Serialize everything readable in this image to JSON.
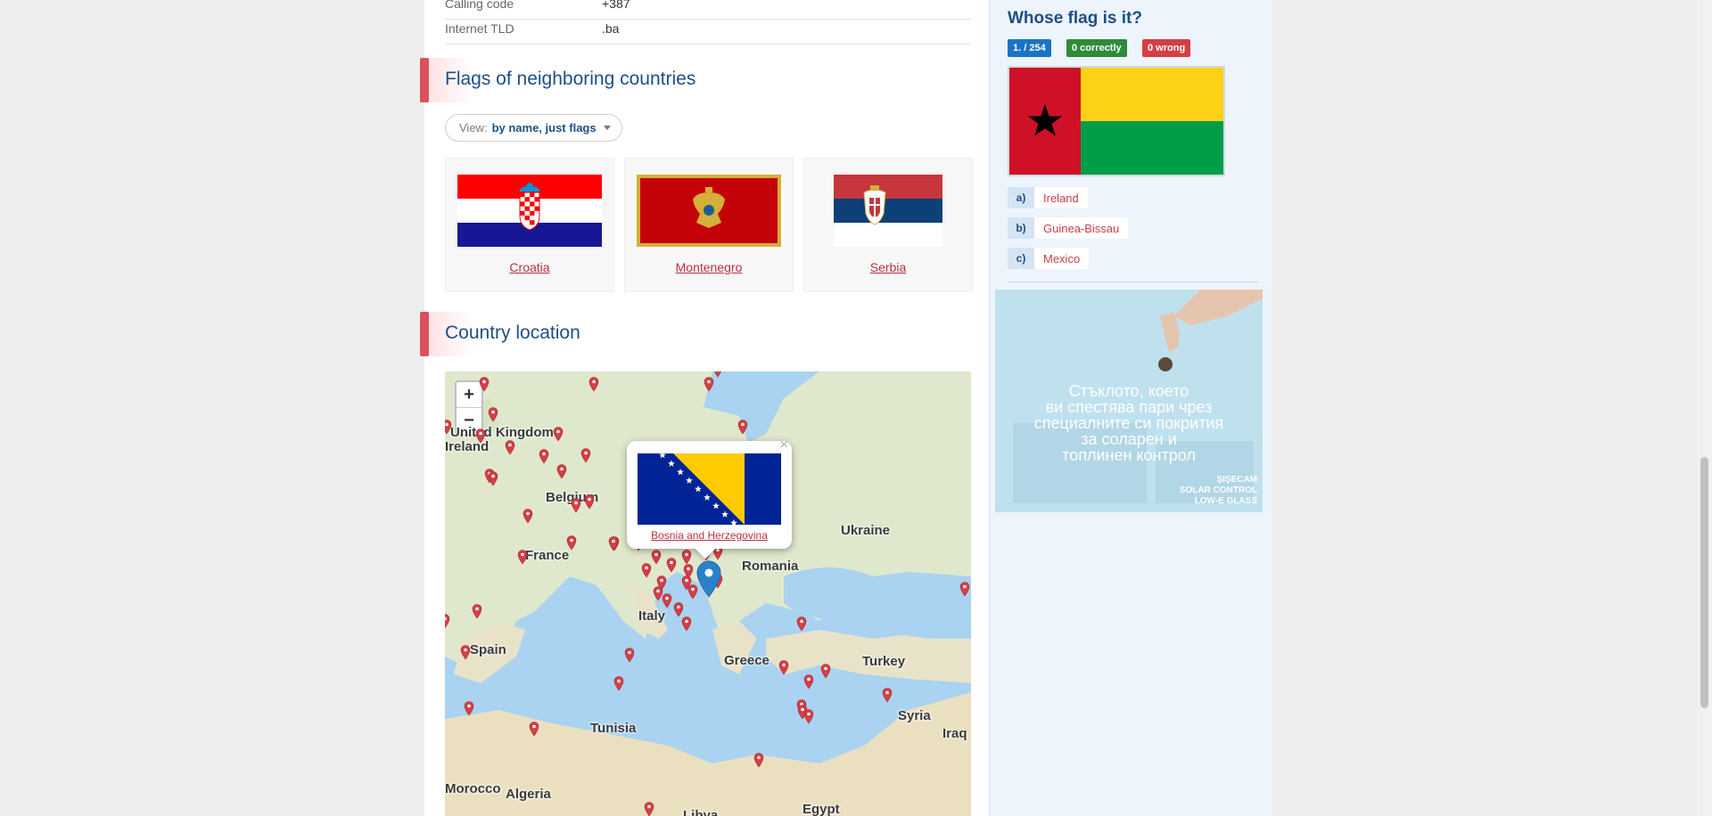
{
  "info_table": {
    "rows": [
      {
        "label": "Calling code",
        "value": "+387"
      },
      {
        "label": "Internet TLD",
        "value": ".ba"
      }
    ]
  },
  "neighbors": {
    "title": "Flags of neighboring countries",
    "view_label": "View:",
    "view_value": "by name, just flags",
    "countries": [
      {
        "name": "Croatia"
      },
      {
        "name": "Montenegro"
      },
      {
        "name": "Serbia"
      }
    ]
  },
  "location": {
    "title": "Country location",
    "zoom_in": "+",
    "zoom_out": "−",
    "labels": [
      "United Kingdom",
      "Ireland",
      "Belgium",
      "France",
      "Spain",
      "Italy",
      "Romania",
      "Ukraine",
      "Greece",
      "Turkey",
      "Syria",
      "Iraq",
      "Tunisia",
      "Algeria",
      "Libya",
      "Egypt",
      "Morocco"
    ],
    "popup": {
      "country": "Bosnia and Herzegovina",
      "close": "×"
    }
  },
  "quiz": {
    "title": "Whose flag is it?",
    "progress": "1. / 254",
    "correct": "0 correctly",
    "wrong": "0 wrong",
    "options": [
      {
        "key": "a)",
        "text": "Ireland"
      },
      {
        "key": "b)",
        "text": "Guinea-Bissau"
      },
      {
        "key": "c)",
        "text": "Mexico"
      }
    ]
  },
  "ad": {
    "lines": [
      "Стъклото, което",
      "ви спестява пари чрез",
      "специалните си покрития",
      "за соларен и",
      "топлинен контрол"
    ],
    "brand": "ŞIŞECAM",
    "brand_sub1": "SOLAR CONTROL",
    "brand_sub2": "LOW-E GLASS"
  },
  "colors": {
    "accent": "#1d4f86",
    "link": "#b5333f",
    "badge_blue": "#1a74c4",
    "badge_green": "#2e8b3a",
    "badge_red": "#d23f45"
  }
}
